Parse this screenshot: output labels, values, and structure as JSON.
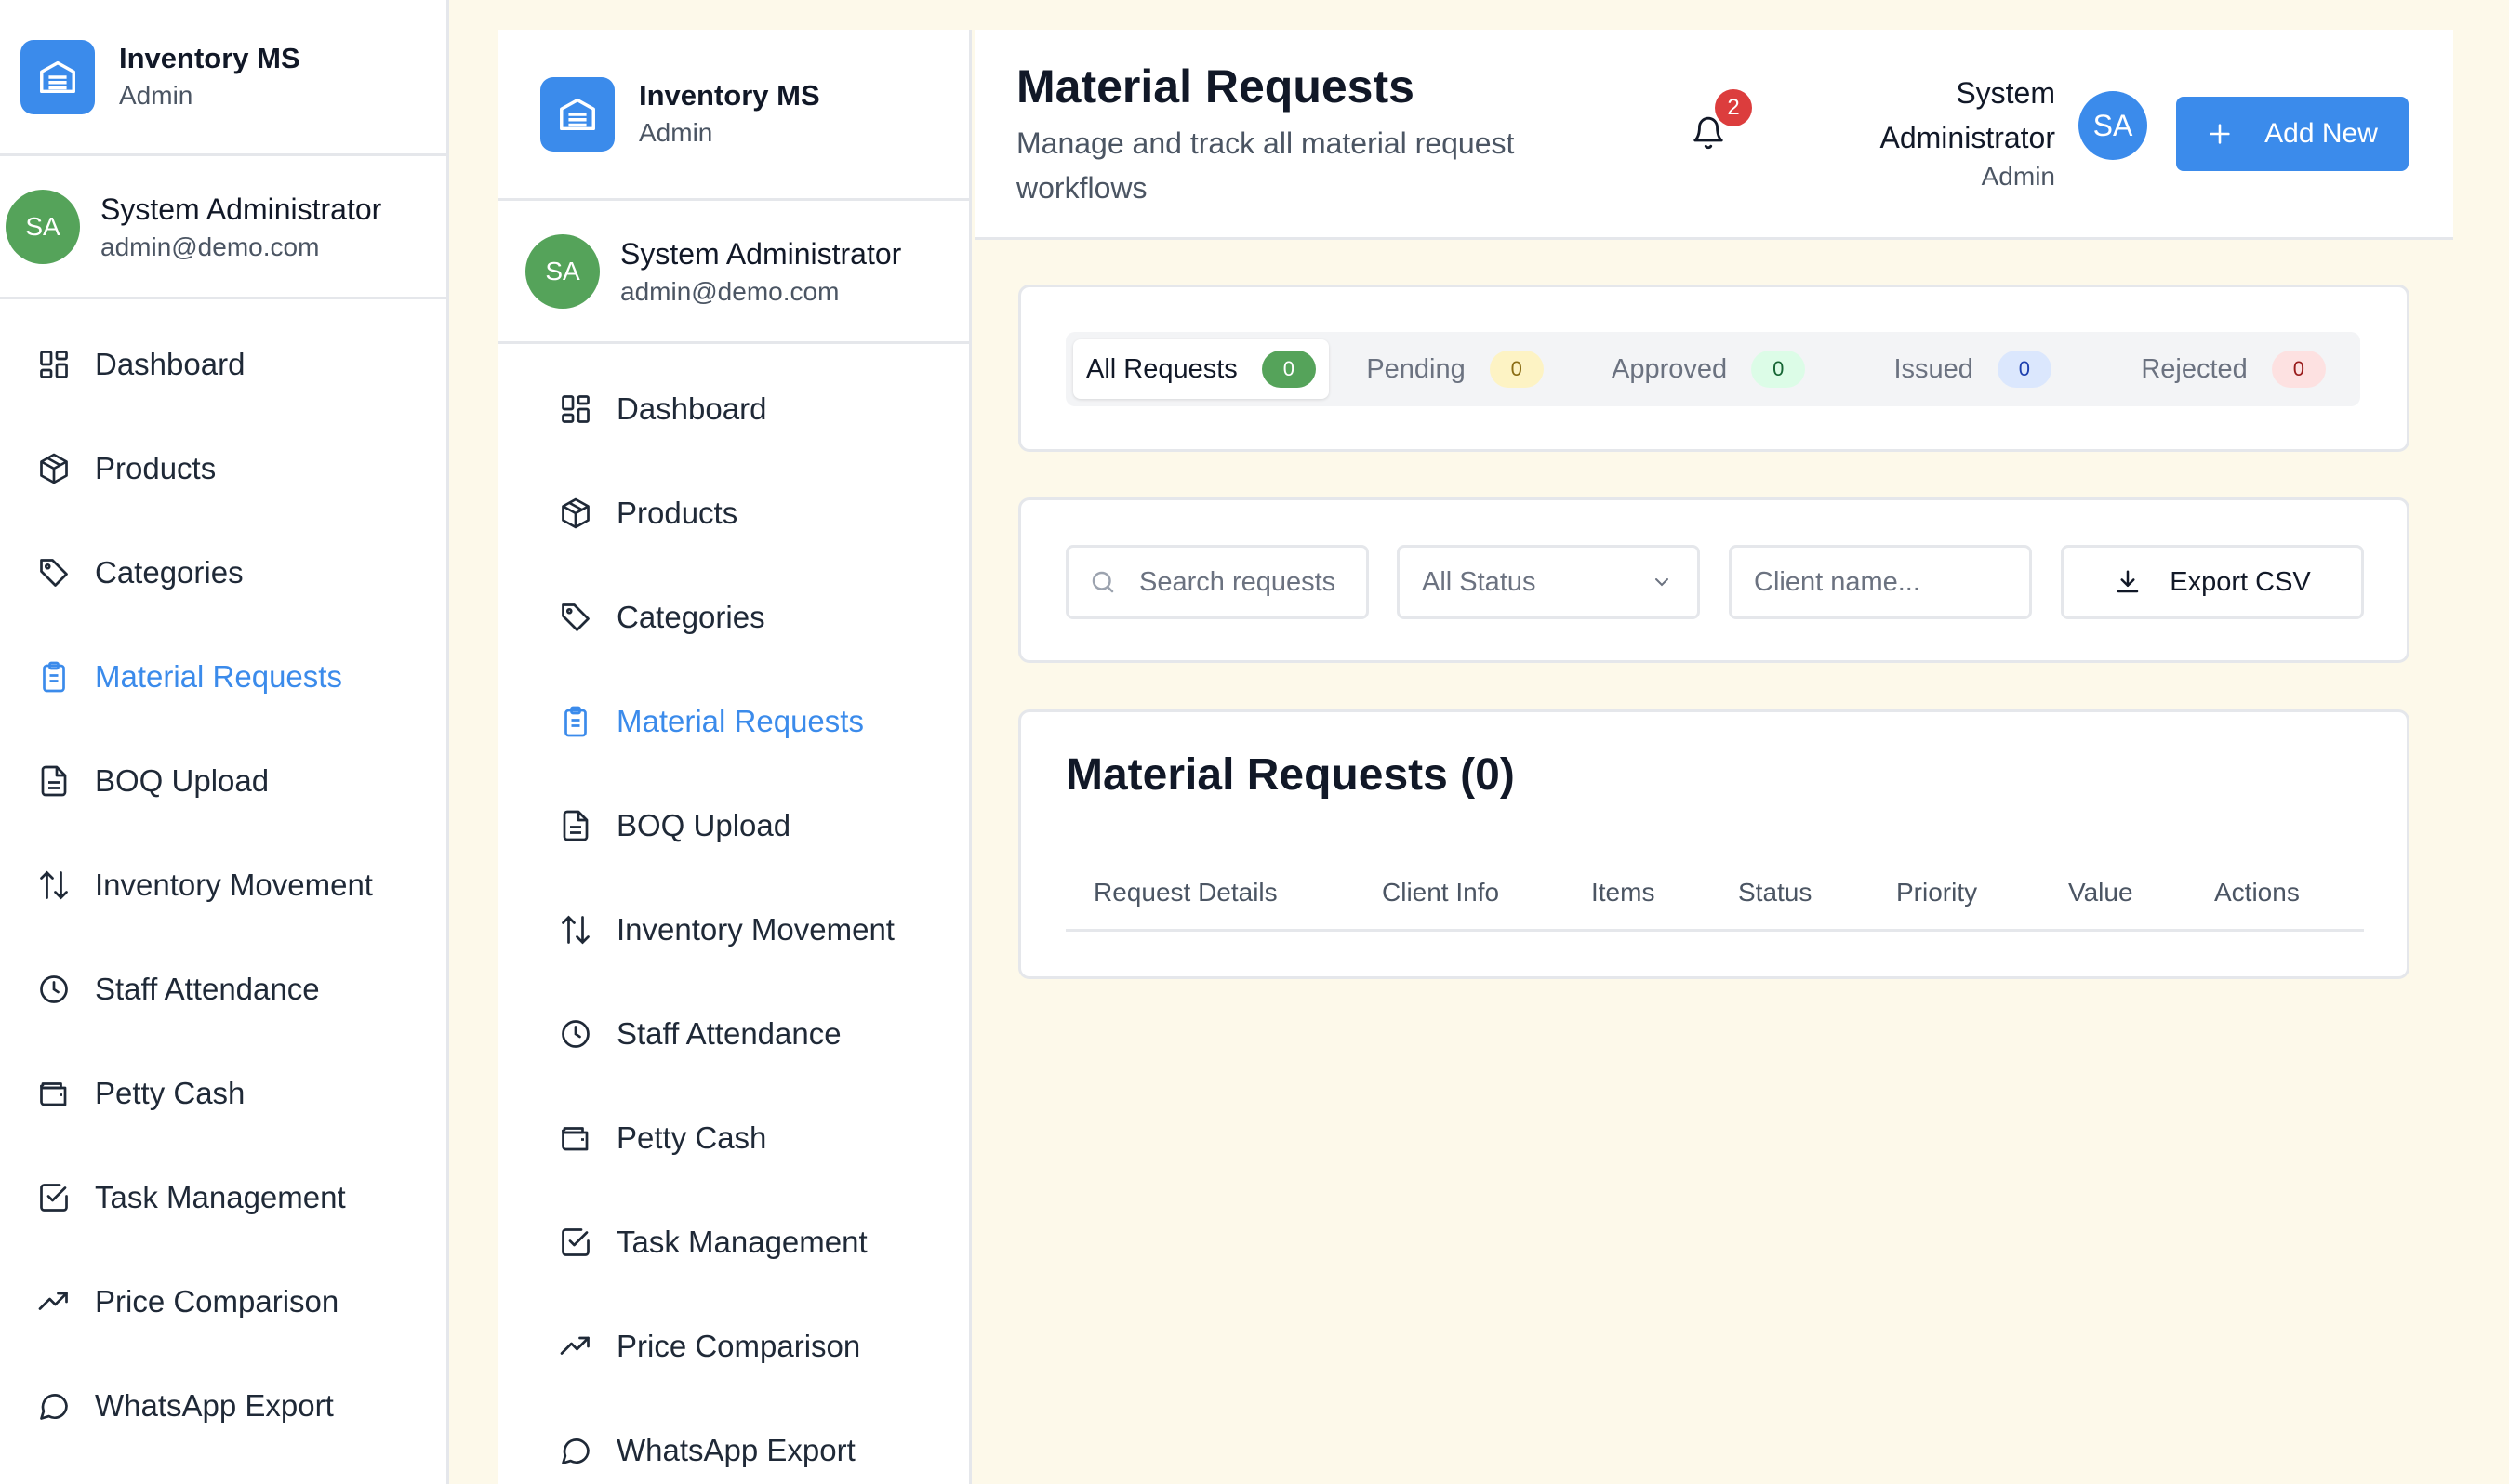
{
  "brand": {
    "title": "Inventory MS",
    "subtitle": "Admin"
  },
  "user": {
    "initials": "SA",
    "name": "System Administrator",
    "email": "admin@demo.com"
  },
  "nav": [
    {
      "label": "Dashboard",
      "icon": "dashboard-icon"
    },
    {
      "label": "Products",
      "icon": "box-icon"
    },
    {
      "label": "Categories",
      "icon": "tag-icon"
    },
    {
      "label": "Material Requests",
      "icon": "clipboard-list-icon",
      "active": true
    },
    {
      "label": "BOQ Upload",
      "icon": "file-text-icon"
    },
    {
      "label": "Inventory Movement",
      "icon": "arrows-up-down-icon"
    },
    {
      "label": "Staff Attendance",
      "icon": "clock-icon"
    },
    {
      "label": "Petty Cash",
      "icon": "wallet-icon"
    },
    {
      "label": "Task Management",
      "icon": "check-square-icon"
    },
    {
      "label": "Price Comparison",
      "icon": "trending-up-icon"
    },
    {
      "label": "WhatsApp Export",
      "icon": "message-circle-icon"
    }
  ],
  "header": {
    "title": "Material Requests",
    "subtitle": "Manage and track all material request workflows",
    "notification_count": "2",
    "user_name_line1": "System",
    "user_name_line2": "Administrator",
    "user_role": "Admin",
    "user_initials": "SA",
    "add_button": "Add New"
  },
  "tabs": [
    {
      "label": "All Requests",
      "count": "0",
      "active": true
    },
    {
      "label": "Pending",
      "count": "0"
    },
    {
      "label": "Approved",
      "count": "0"
    },
    {
      "label": "Issued",
      "count": "0"
    },
    {
      "label": "Rejected",
      "count": "0"
    }
  ],
  "filters": {
    "search_placeholder": "Search requests",
    "status_selected": "All Status",
    "client_placeholder": "Client name...",
    "export_label": "Export CSV"
  },
  "table": {
    "title": "Material Requests (0)",
    "columns": [
      "Request Details",
      "Client Info",
      "Items",
      "Status",
      "Priority",
      "Value",
      "Actions"
    ],
    "rows": []
  },
  "colors": {
    "accent": "#3b8beb",
    "avatar_green": "#55a35a",
    "badge_red": "#dc3d3d",
    "background": "#fdf9ea"
  }
}
